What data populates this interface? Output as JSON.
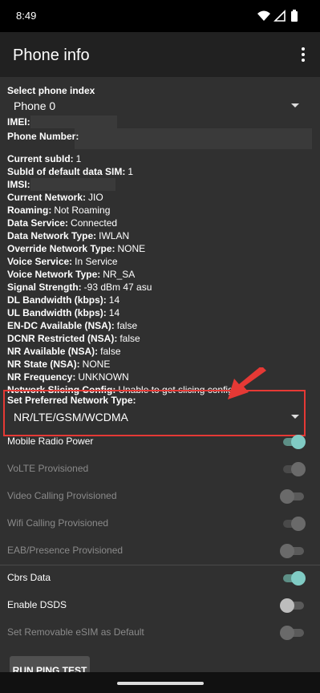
{
  "status_bar": {
    "time": "8:49",
    "icons": [
      "wifi-icon",
      "cellular-icon",
      "battery-icon"
    ]
  },
  "app_bar": {
    "title": "Phone info",
    "menu_icon": "more-vert-icon"
  },
  "phone_index": {
    "label": "Select phone index",
    "value": "Phone 0"
  },
  "info": [
    {
      "key": "imei",
      "label": "IMEI:",
      "value": ""
    },
    {
      "key": "phone_number",
      "label": "Phone Number:",
      "value": ""
    },
    {
      "key": "current_subid",
      "label": "Current subId:",
      "value": "1"
    },
    {
      "key": "subid_default",
      "label": "SubId of default data SIM:",
      "value": "1"
    },
    {
      "key": "imsi",
      "label": "IMSI:",
      "value": ""
    },
    {
      "key": "current_network",
      "label": "Current Network:",
      "value": "JIO"
    },
    {
      "key": "roaming",
      "label": "Roaming:",
      "value": "Not Roaming"
    },
    {
      "key": "data_service",
      "label": "Data Service:",
      "value": "Connected"
    },
    {
      "key": "data_network_type",
      "label": "Data Network Type:",
      "value": "IWLAN"
    },
    {
      "key": "override_network_type",
      "label": "Override Network Type:",
      "value": "NONE"
    },
    {
      "key": "voice_service",
      "label": "Voice Service:",
      "value": "In Service"
    },
    {
      "key": "voice_network_type",
      "label": "Voice Network Type:",
      "value": "NR_SA"
    },
    {
      "key": "signal_strength",
      "label": "Signal Strength:",
      "value": "-93 dBm   47 asu"
    },
    {
      "key": "dl_bandwidth",
      "label": "DL Bandwidth (kbps):",
      "value": "14"
    },
    {
      "key": "ul_bandwidth",
      "label": "UL Bandwidth (kbps):",
      "value": "14"
    },
    {
      "key": "endc_available",
      "label": "EN-DC Available (NSA):",
      "value": "false"
    },
    {
      "key": "dcnr_restricted",
      "label": "DCNR Restricted (NSA):",
      "value": "false"
    },
    {
      "key": "nr_available",
      "label": "NR Available (NSA):",
      "value": "false"
    },
    {
      "key": "nr_state",
      "label": "NR State (NSA):",
      "value": "NONE"
    },
    {
      "key": "nr_frequency",
      "label": "NR Frequency:",
      "value": "UNKNOWN"
    },
    {
      "key": "network_slicing",
      "label": "Network Slicing Config:",
      "value": "Unable to get slicing config."
    }
  ],
  "preferred_network": {
    "label": "Set Preferred Network Type:",
    "value": "NR/LTE/GSM/WCDMA"
  },
  "toggles": [
    {
      "label": "Mobile Radio Power",
      "state": "on",
      "enabled": true
    },
    {
      "label": "VoLTE Provisioned",
      "state": "on",
      "enabled": false
    },
    {
      "label": "Video Calling Provisioned",
      "state": "off",
      "enabled": false
    },
    {
      "label": "Wifi Calling Provisioned",
      "state": "on",
      "enabled": false
    },
    {
      "label": "EAB/Presence Provisioned",
      "state": "off",
      "enabled": false
    },
    {
      "label": "Cbrs Data",
      "state": "on",
      "enabled": true
    },
    {
      "label": "Enable DSDS",
      "state": "off",
      "enabled": true
    },
    {
      "label": "Set Removable eSIM as Default",
      "state": "off",
      "enabled": false
    }
  ],
  "ping_button": {
    "label": "RUN PING TEST"
  },
  "colors": {
    "highlight": "#e53935",
    "accent": "#80cbc4",
    "background": "#303030"
  }
}
